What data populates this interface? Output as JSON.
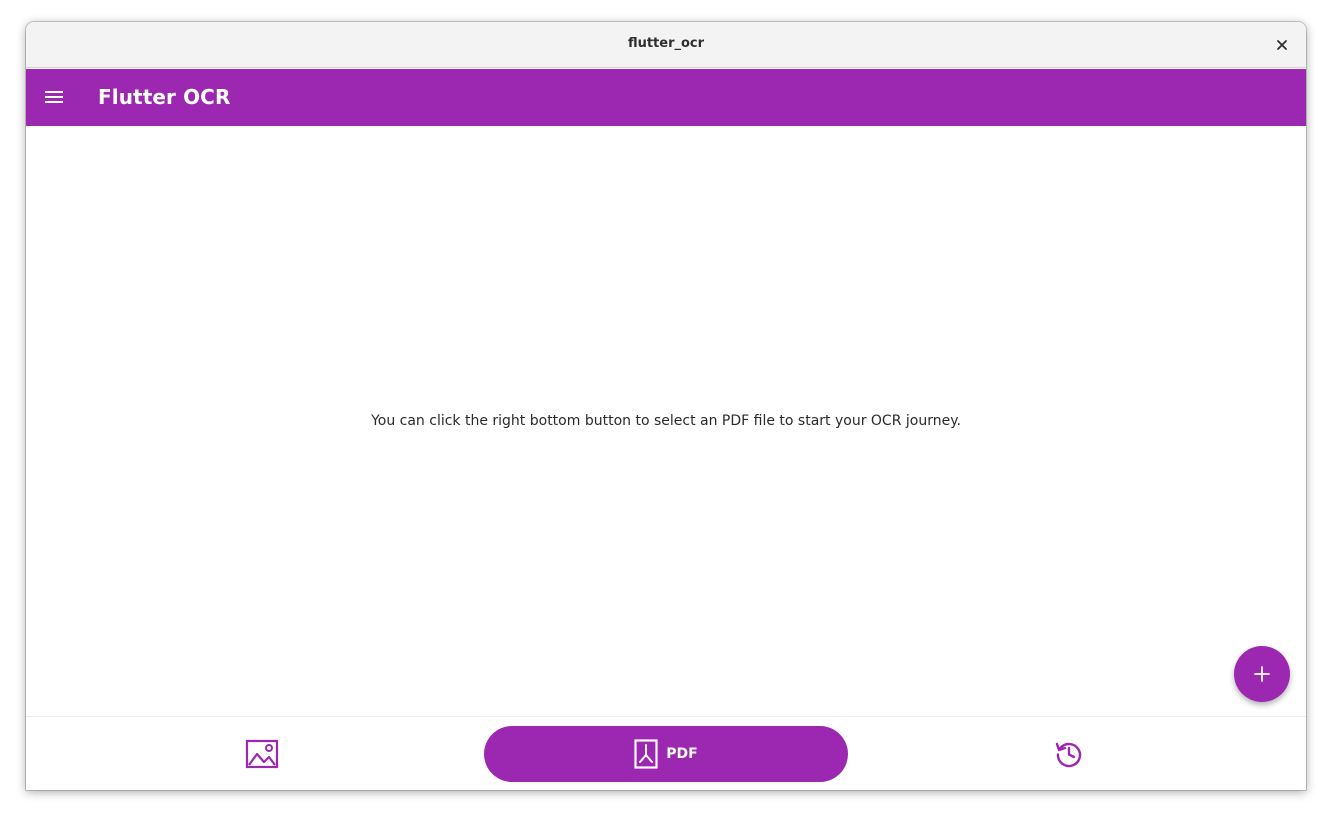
{
  "window": {
    "title": "flutter_ocr"
  },
  "appbar": {
    "title": "Flutter OCR",
    "menu_icon": "menu-icon"
  },
  "content": {
    "message": "You can click the right bottom button to select an PDF file to start your OCR journey."
  },
  "fab": {
    "icon": "plus-icon"
  },
  "bottom_nav": {
    "items": [
      {
        "icon": "image-icon",
        "label": ""
      },
      {
        "icon": "pdf-icon",
        "label": "PDF",
        "selected": true
      },
      {
        "icon": "history-icon",
        "label": ""
      }
    ]
  },
  "colors": {
    "primary": "#9c27b0",
    "titlebar": "#f3f3f3",
    "background": "#ffffff"
  }
}
